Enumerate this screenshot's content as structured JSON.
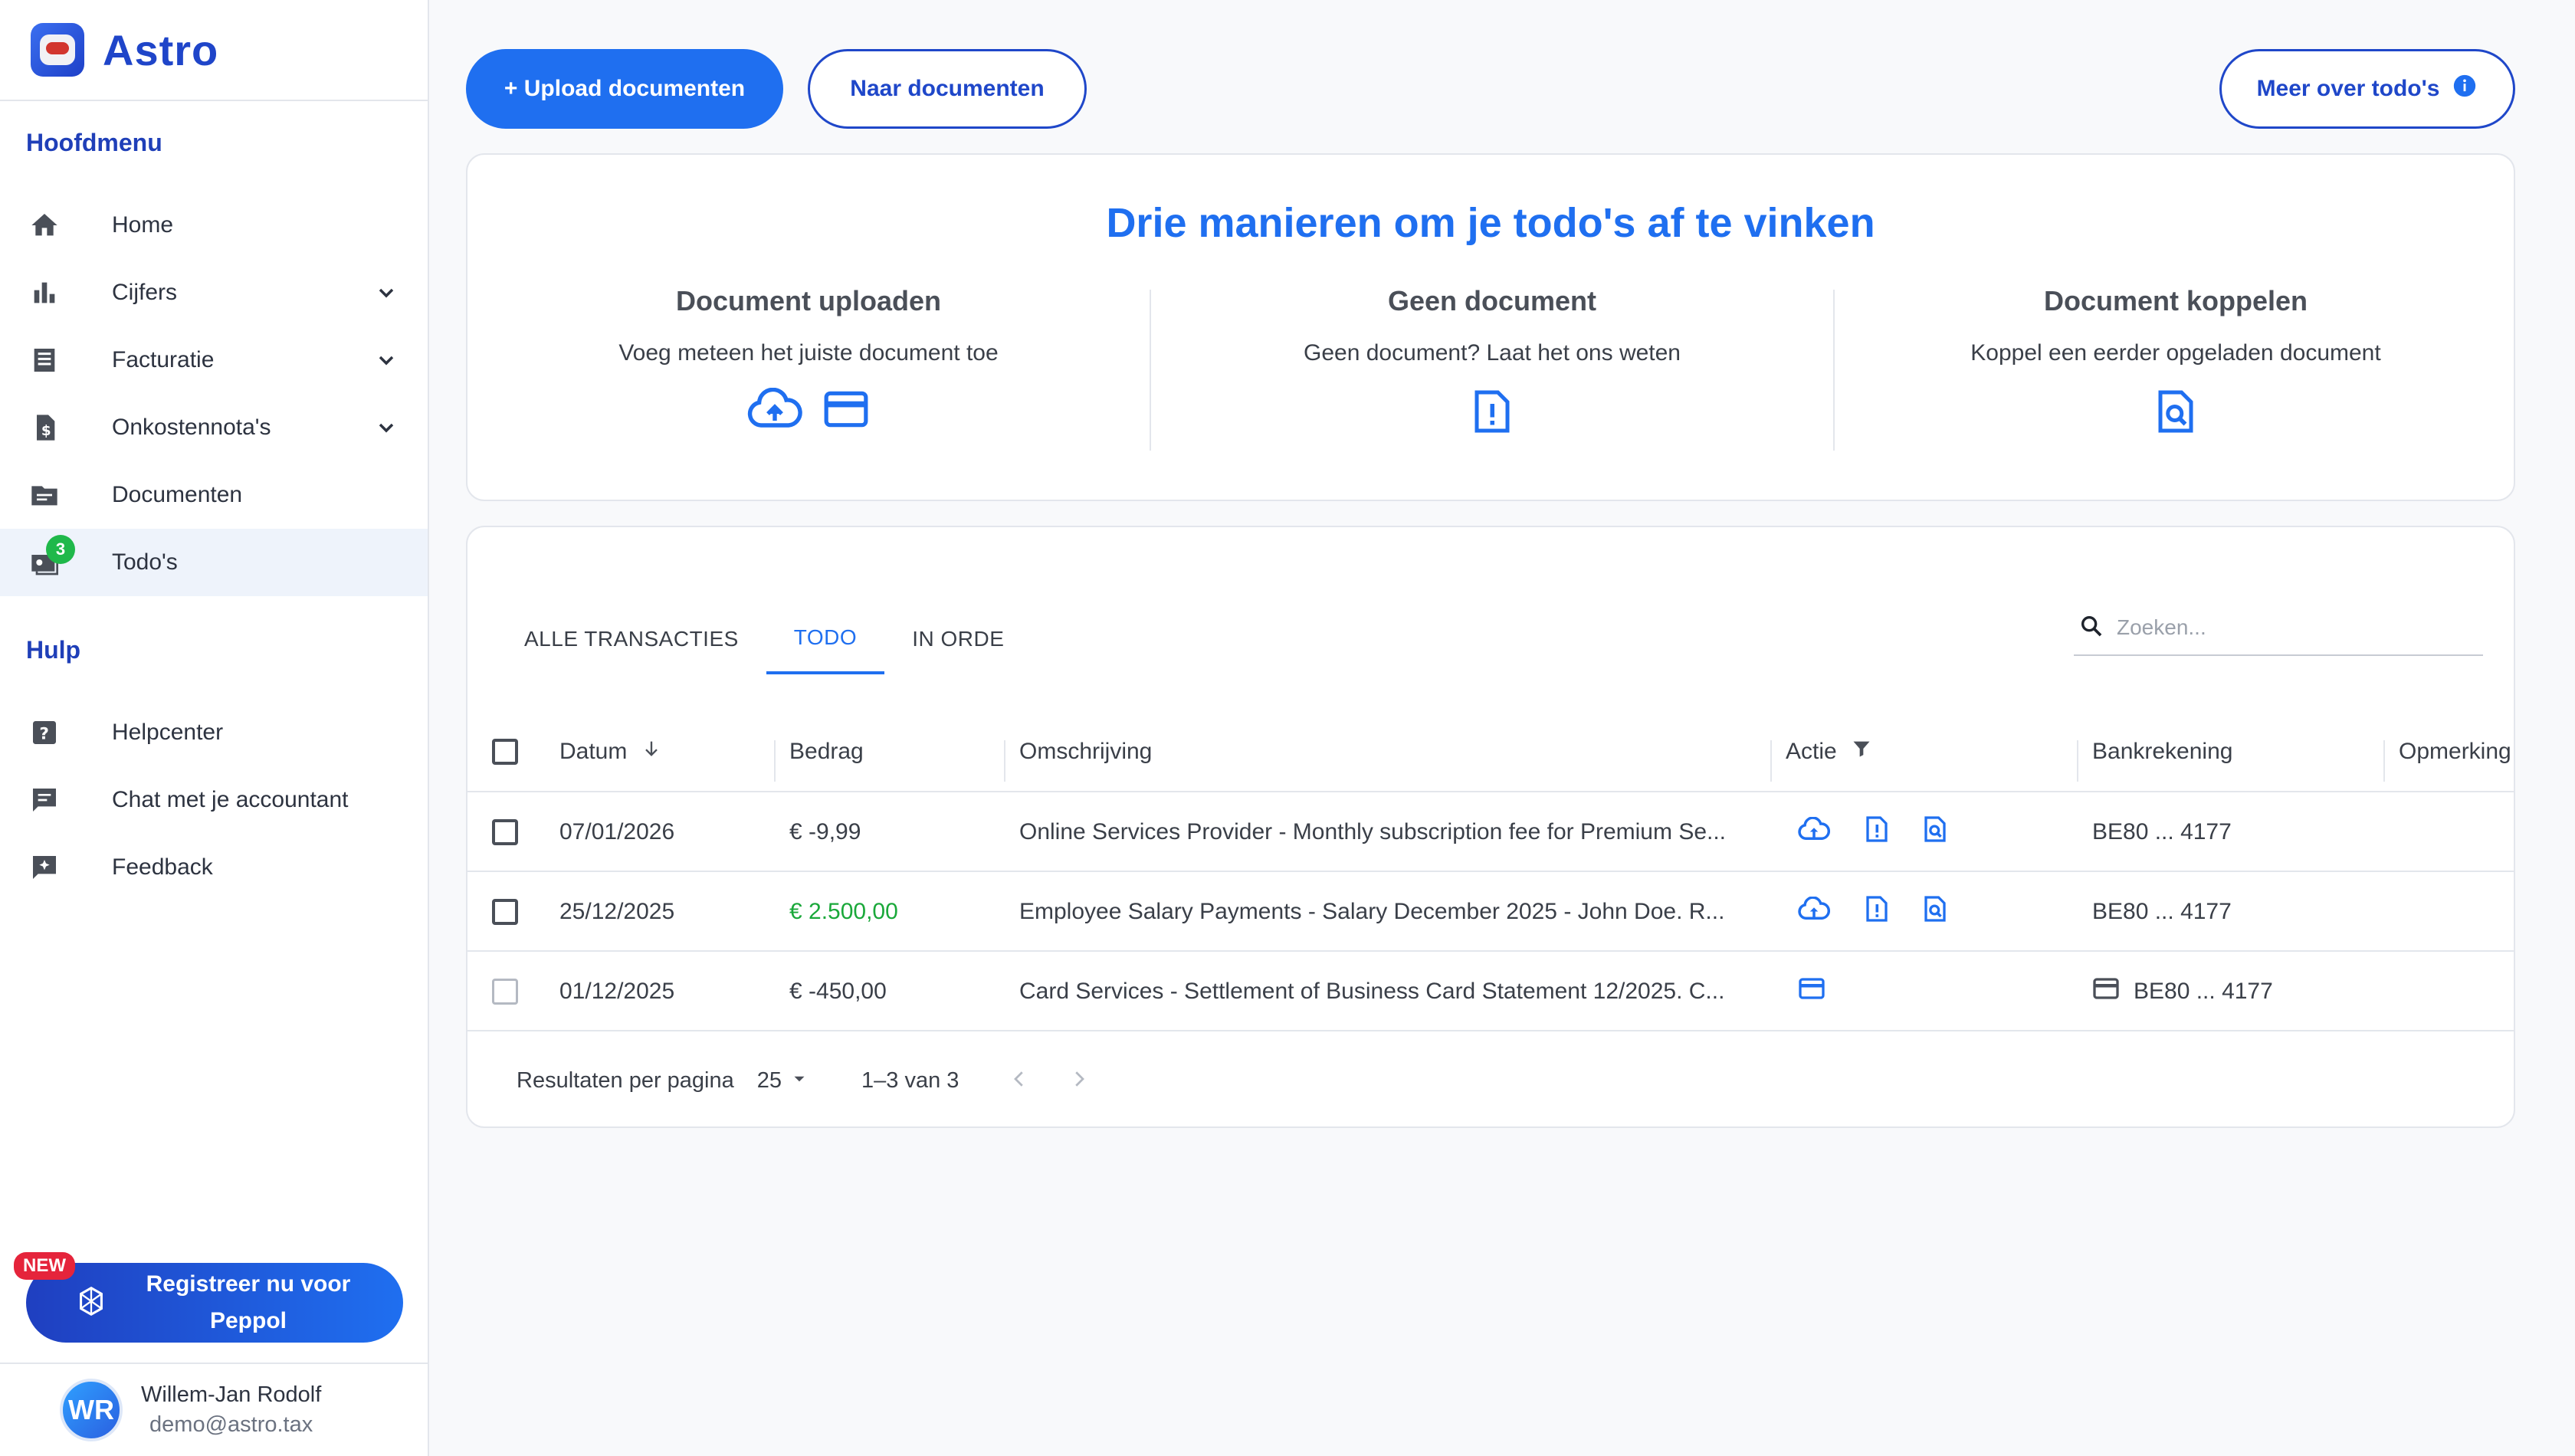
{
  "app": {
    "name": "Astro"
  },
  "sidebar": {
    "main_title": "Hoofdmenu",
    "main_items": [
      {
        "label": "Home",
        "icon": "home-icon",
        "expandable": false
      },
      {
        "label": "Cijfers",
        "icon": "bar-chart-icon",
        "expandable": true
      },
      {
        "label": "Facturatie",
        "icon": "receipt-icon",
        "expandable": true
      },
      {
        "label": "Onkostennota's",
        "icon": "expense-note-icon",
        "expandable": true
      },
      {
        "label": "Documenten",
        "icon": "folder-icon",
        "expandable": false
      },
      {
        "label": "Todo's",
        "icon": "todo-icon",
        "expandable": false,
        "badge": "3",
        "active": true
      }
    ],
    "help_title": "Hulp",
    "help_items": [
      {
        "label": "Helpcenter",
        "icon": "help-icon"
      },
      {
        "label": "Chat met je accountant",
        "icon": "chat-icon"
      },
      {
        "label": "Feedback",
        "icon": "feedback-icon"
      }
    ],
    "peppol": {
      "new_badge": "NEW",
      "label": "Registreer nu voor Peppol"
    },
    "user": {
      "initials": "WR",
      "name": "Willem-Jan Rodolf",
      "email": "demo@astro.tax"
    }
  },
  "toolbar": {
    "upload_label": "+ Upload documenten",
    "documents_label": "Naar documenten",
    "more_label": "Meer over todo's"
  },
  "info": {
    "title": "Drie manieren om je todo's af te vinken",
    "columns": [
      {
        "title": "Document uploaden",
        "text": "Voeg meteen het juiste document toe"
      },
      {
        "title": "Geen document",
        "text": "Geen document? Laat het ons weten"
      },
      {
        "title": "Document koppelen",
        "text": "Koppel een eerder opgeladen document"
      }
    ]
  },
  "tabs": [
    {
      "label": "ALLE TRANSACTIES",
      "active": false
    },
    {
      "label": "TODO",
      "active": true
    },
    {
      "label": "IN ORDE",
      "active": false
    }
  ],
  "search": {
    "placeholder": "Zoeken..."
  },
  "table": {
    "headers": {
      "date": "Datum",
      "amount": "Bedrag",
      "description": "Omschrijving",
      "action": "Actie",
      "account": "Bankrekening",
      "remark": "Opmerking"
    },
    "rows": [
      {
        "date": "07/01/2026",
        "amount": "€ -9,99",
        "positive": false,
        "description": "Online Services Provider - Monthly subscription fee for Premium Se...",
        "actions": [
          "upload",
          "no-document",
          "link-document"
        ],
        "account": "BE80 ... 4177",
        "card": false
      },
      {
        "date": "25/12/2025",
        "amount": "€ 2.500,00",
        "positive": true,
        "description": "Employee Salary Payments - Salary December 2025 - John Doe. R...",
        "actions": [
          "upload",
          "no-document",
          "link-document"
        ],
        "account": "BE80 ... 4177",
        "card": false
      },
      {
        "date": "01/12/2025",
        "amount": "€ -450,00",
        "positive": false,
        "description": "Card Services - Settlement of Business Card Statement 12/2025. C...",
        "actions": [
          "card"
        ],
        "account": "BE80 ... 4177",
        "card": true
      }
    ]
  },
  "pagination": {
    "per_page_label": "Resultaten per pagina",
    "per_page_value": "25",
    "range": "1–3 van 3"
  },
  "colors": {
    "accent": "#1f6ff0",
    "brand": "#1f45c9",
    "positive": "#1aa83a",
    "badge_green": "#1fb84a",
    "new_red": "#e5243b"
  }
}
